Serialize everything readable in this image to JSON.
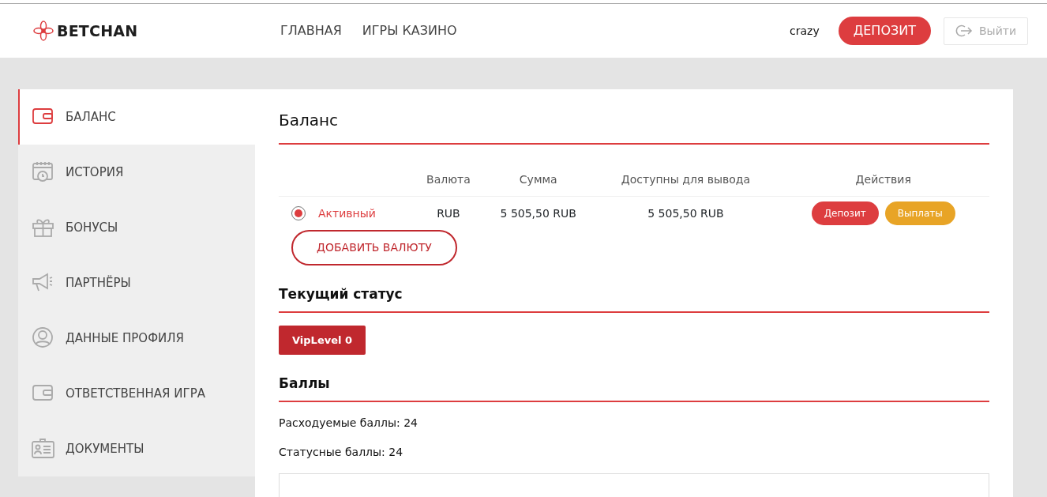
{
  "header": {
    "logo": "BETCHAN",
    "nav": [
      {
        "label": "ГЛАВНАЯ"
      },
      {
        "label": "ИГРЫ КАЗИНО"
      }
    ],
    "username": "crazy",
    "deposit_button": "ДЕПОЗИТ",
    "logout_button": "Выйти"
  },
  "sidebar": {
    "items": [
      {
        "label": "БАЛАНС",
        "selected": true
      },
      {
        "label": "ИСТОРИЯ",
        "selected": false
      },
      {
        "label": "БОНУСЫ",
        "selected": false
      },
      {
        "label": "ПАРТНЁРЫ",
        "selected": false
      },
      {
        "label": "ДАННЫЕ ПРОФИЛЯ",
        "selected": false
      },
      {
        "label": "ОТВЕТСТВЕННАЯ ИГРА",
        "selected": false
      },
      {
        "label": "ДОКУМЕНТЫ",
        "selected": false
      }
    ]
  },
  "balance": {
    "title": "Баланс",
    "table": {
      "columns": [
        "",
        "Валюта",
        "Сумма",
        "Доступны для вывода",
        "Действия"
      ],
      "rows": [
        {
          "selected": true,
          "status": "Активный",
          "currency": "RUB",
          "sum": "5 505,50 RUB",
          "available": "5 505,50 RUB",
          "actions": [
            {
              "label": "Депозит",
              "kind": "deposit"
            },
            {
              "label": "Выплаты",
              "kind": "payout"
            }
          ]
        }
      ]
    },
    "add_currency_button": "ДОБАВИТЬ ВАЛЮТУ"
  },
  "status": {
    "title": "Текущий статус",
    "badge": "VipLevel 0"
  },
  "points": {
    "title": "Баллы",
    "lines": [
      "Расходуемые баллы: 24",
      "Статусные баллы: 24"
    ]
  }
}
